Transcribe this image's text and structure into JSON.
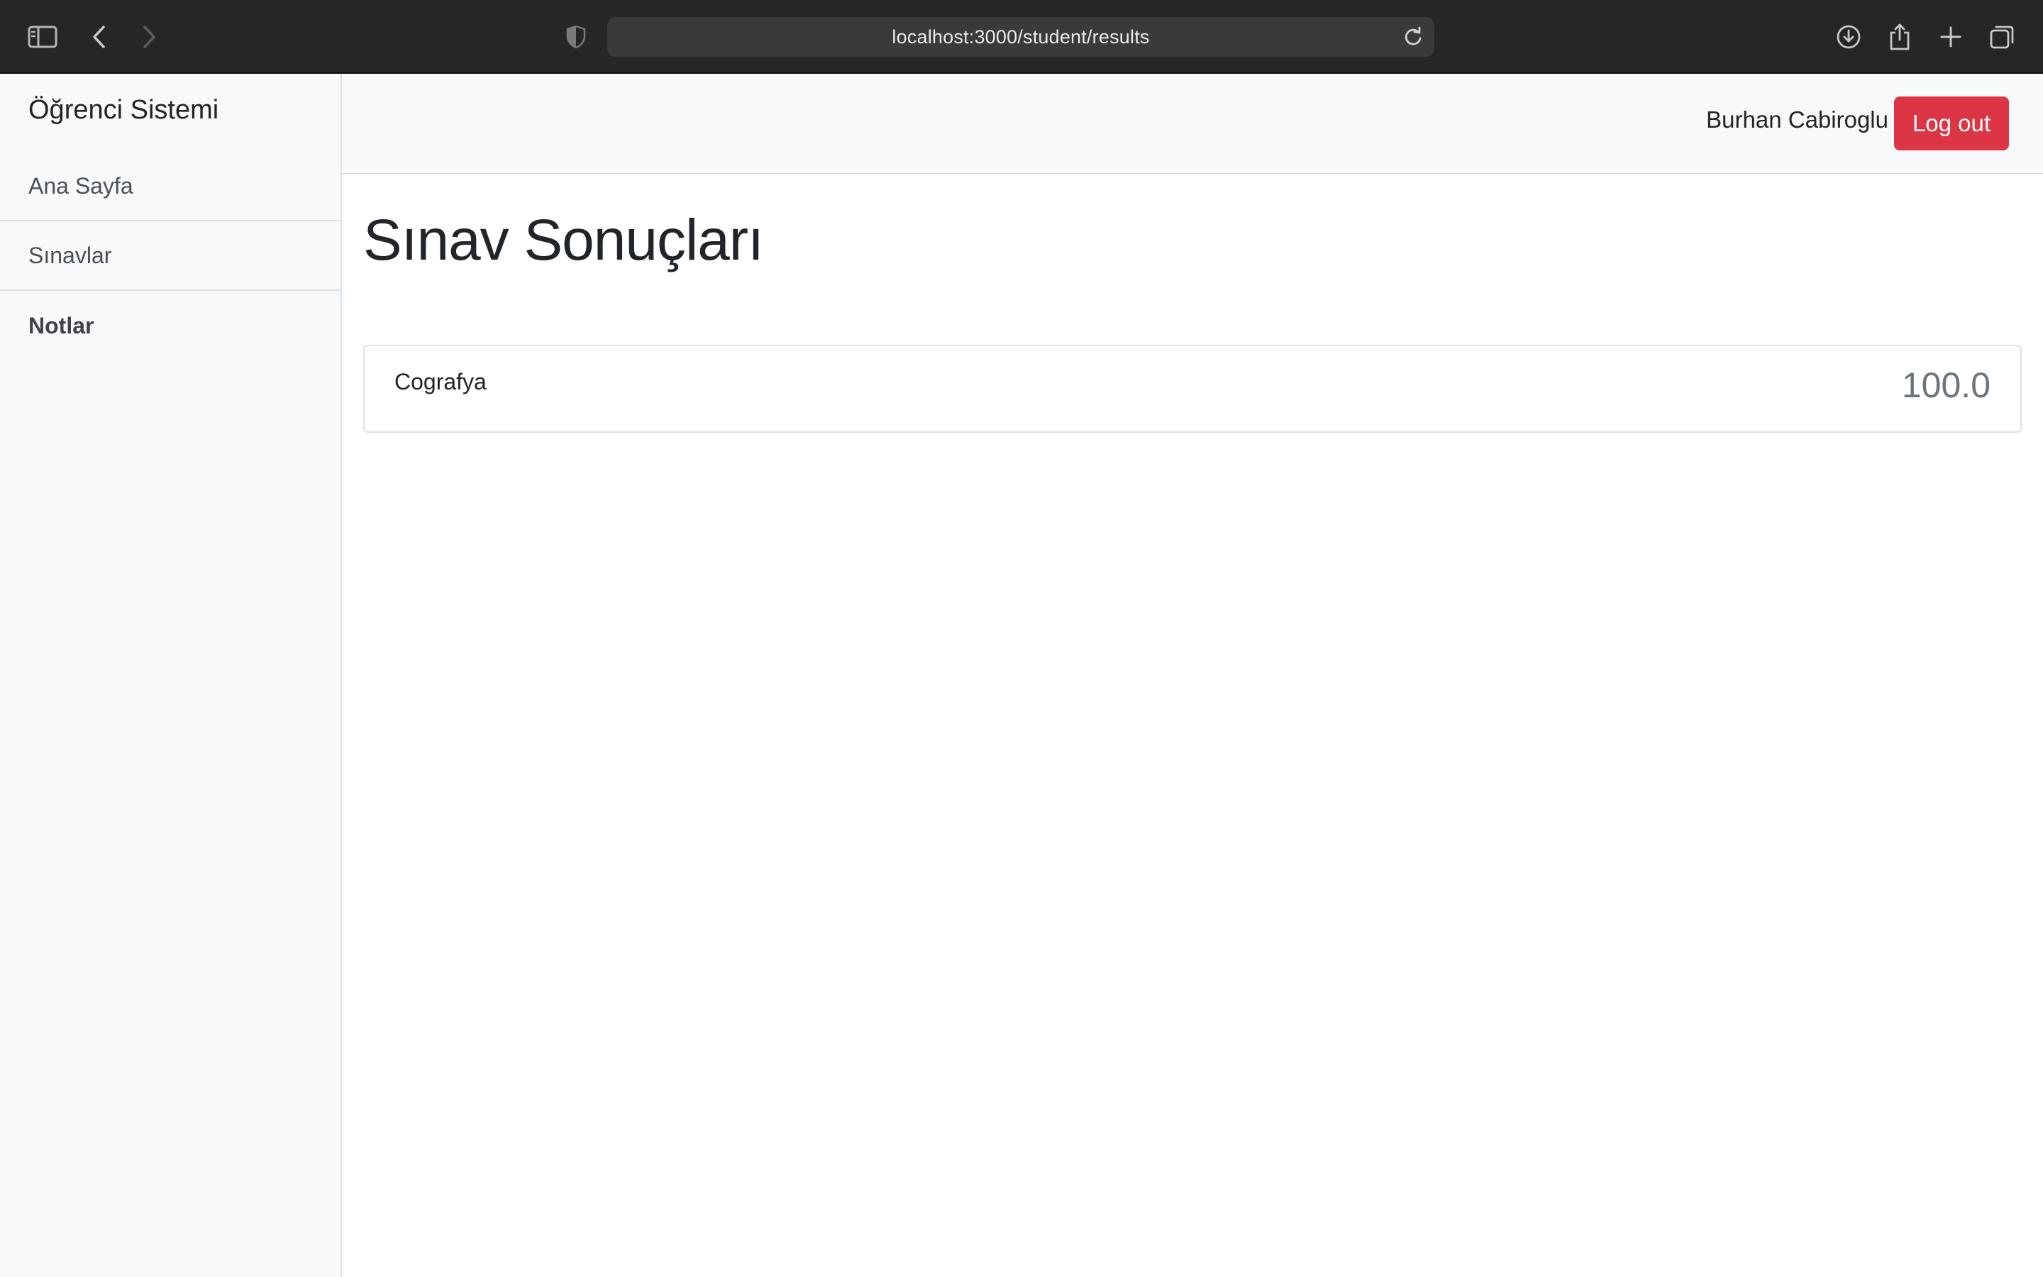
{
  "browser": {
    "url": "localhost:3000/student/results",
    "icons": [
      "sidebar-toggle-icon",
      "back-icon",
      "forward-icon",
      "shield-icon",
      "reload-icon",
      "download-icon",
      "share-icon",
      "new-tab-icon",
      "tab-overview-icon"
    ]
  },
  "sidebar": {
    "brand": "Öğrenci Sistemi",
    "items": [
      {
        "label": "Ana Sayfa",
        "active": false
      },
      {
        "label": "Sınavlar",
        "active": false
      },
      {
        "label": "Notlar",
        "active": true
      }
    ]
  },
  "topbar": {
    "username": "Burhan Cabiroglu",
    "logout_label": "Log out"
  },
  "main": {
    "title": "Sınav Sonuçları",
    "results": [
      {
        "subject": "Cografya",
        "score": "100.0"
      }
    ]
  },
  "colors": {
    "danger": "#dc3545",
    "sidebar_bg": "#f8f9fa",
    "score_text": "#6c757d",
    "chrome_bg": "#262626"
  }
}
